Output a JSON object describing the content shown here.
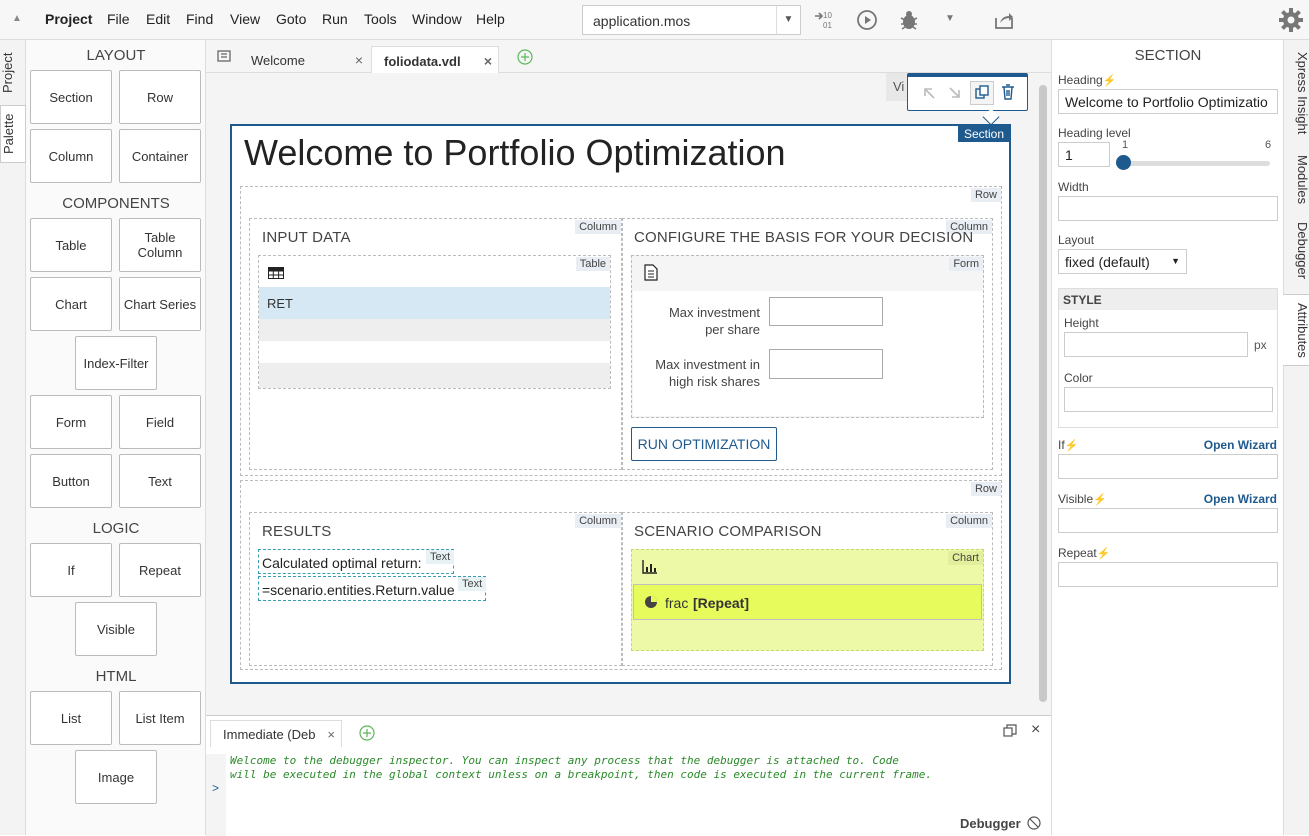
{
  "menu": {
    "items": [
      "Project",
      "File",
      "Edit",
      "Find",
      "View",
      "Goto",
      "Run",
      "Tools",
      "Window",
      "Help"
    ],
    "project_select": "application.mos"
  },
  "left_tabs": {
    "project": "Project",
    "palette": "Palette"
  },
  "palette": {
    "layout_heading": "LAYOUT",
    "layout": [
      "Section",
      "Row",
      "Column",
      "Container"
    ],
    "components_heading": "COMPONENTS",
    "components": [
      "Table",
      "Table Column",
      "Chart",
      "Chart Series",
      "Index-Filter",
      "Form",
      "Field",
      "Button",
      "Text"
    ],
    "logic_heading": "LOGIC",
    "logic": [
      "If",
      "Repeat",
      "Visible"
    ],
    "html_heading": "HTML",
    "html": [
      "List",
      "List Item",
      "Image"
    ]
  },
  "editor": {
    "tabs": [
      {
        "label": "Welcome",
        "active": false
      },
      {
        "label": "foliodata.vdl",
        "active": true
      }
    ],
    "view_label": "Vi",
    "section_tag": "Section",
    "heading": "Welcome to Portfolio Optimization",
    "row_tag": "Row",
    "column_tag": "Column",
    "table_tag": "Table",
    "form_tag": "Form",
    "chart_tag": "Chart",
    "text_tag": "Text",
    "input_data_title": "INPUT DATA",
    "table_row_value": "RET",
    "configure_title": "CONFIGURE THE BASIS FOR YOUR DECISION",
    "field1_label": "Max investment per share",
    "field2_label": "Max investment in high risk shares",
    "run_button": "RUN OPTIMIZATION",
    "results_title": "RESULTS",
    "results_text1": "Calculated optimal return:",
    "results_text2": "=scenario.entities.Return.value",
    "scenario_title": "SCENARIO COMPARISON",
    "series_label": "frac",
    "series_repeat": "[Repeat]"
  },
  "immediate": {
    "tab_label": "Immediate (Deb",
    "message_line1": "Welcome to the debugger inspector. You can inspect any process that the debugger is attached to. Code",
    "message_line2": "will be executed in the global context unless on a breakpoint, then code is executed in the current frame.",
    "prompt": ">",
    "status_label": "Debugger"
  },
  "attributes": {
    "title": "SECTION",
    "heading_label": "Heading",
    "heading_value": "Welcome to Portfolio Optimizatio",
    "heading_level_label": "Heading level",
    "heading_level_value": "1",
    "slider_min": "1",
    "slider_max": "6",
    "width_label": "Width",
    "layout_label": "Layout",
    "layout_value": "fixed (default)",
    "style_heading": "STYLE",
    "height_label": "Height",
    "height_unit": "px",
    "color_label": "Color",
    "if_label": "If",
    "visible_label": "Visible",
    "repeat_label": "Repeat",
    "open_wizard": "Open Wizard"
  },
  "right_tabs": [
    "Xpress Insight",
    "Modules",
    "Debugger",
    "Attributes"
  ],
  "colors": {
    "accent": "#1e5a8e",
    "chart_bg": "#eef9a8",
    "chart_repeat": "#e8fb5c",
    "lightning": "#f0a800",
    "debug_text": "#2a8a2a"
  }
}
